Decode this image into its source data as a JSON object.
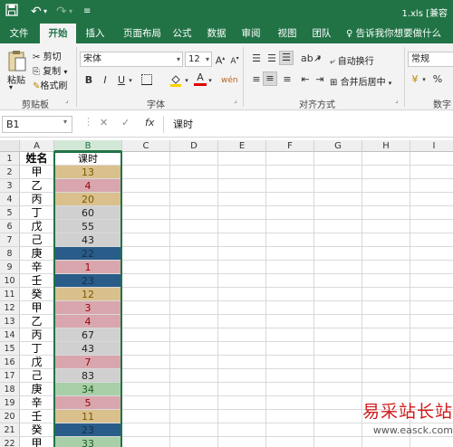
{
  "title_bar": {
    "save_icon": "save-icon",
    "undo_icon": "undo-icon",
    "redo_icon": "redo-icon",
    "customize_icon": "customize-qat-icon",
    "file_title": "1.xls [兼容"
  },
  "tabs": [
    "文件",
    "开始",
    "插入",
    "页面布局",
    "公式",
    "数据",
    "审阅",
    "视图",
    "团队"
  ],
  "tell_me": "告诉我你想要做什么",
  "ribbon": {
    "paste_label": "粘贴",
    "cut_label": "剪切",
    "copy_label": "复制",
    "format_painter_label": "格式刷",
    "clipboard_group": "剪贴板",
    "font_name": "宋体",
    "font_size": "12",
    "bold": "B",
    "italic": "I",
    "underline": "U",
    "font_group": "字体",
    "wrap_text": "自动换行",
    "merge_center": "合并后居中",
    "alignment_group": "对齐方式",
    "number_format": "常规",
    "number_group": "数字",
    "percent": "%"
  },
  "formula_bar": {
    "name_box": "B1",
    "fx": "fx",
    "content": "课时"
  },
  "columns": [
    "A",
    "B",
    "C",
    "D",
    "E",
    "F",
    "G",
    "H",
    "I"
  ],
  "rows": [
    {
      "n": "1",
      "a": "姓名",
      "b": "课时",
      "fill": "#ffffff",
      "color": "#000000"
    },
    {
      "n": "2",
      "a": "甲",
      "b": "13",
      "fill": "#d9c08c",
      "color": "#7a5a00"
    },
    {
      "n": "3",
      "a": "乙",
      "b": "4",
      "fill": "#d9a6ae",
      "color": "#9c0006"
    },
    {
      "n": "4",
      "a": "丙",
      "b": "20",
      "fill": "#d9c08c",
      "color": "#7a5a00"
    },
    {
      "n": "5",
      "a": "丁",
      "b": "60",
      "fill": "#d0d0d0",
      "color": "#222222"
    },
    {
      "n": "6",
      "a": "戊",
      "b": "55",
      "fill": "#d0d0d0",
      "color": "#222222"
    },
    {
      "n": "7",
      "a": "己",
      "b": "43",
      "fill": "#d0d0d0",
      "color": "#222222"
    },
    {
      "n": "8",
      "a": "庚",
      "b": "22",
      "fill": "#2a5c8a",
      "color": "#1a2f4a"
    },
    {
      "n": "9",
      "a": "辛",
      "b": "1",
      "fill": "#d9a6ae",
      "color": "#9c0006"
    },
    {
      "n": "10",
      "a": "壬",
      "b": "23",
      "fill": "#2a5c8a",
      "color": "#1a2f4a"
    },
    {
      "n": "11",
      "a": "癸",
      "b": "12",
      "fill": "#d9c08c",
      "color": "#7a5a00"
    },
    {
      "n": "12",
      "a": "甲",
      "b": "3",
      "fill": "#d9a6ae",
      "color": "#9c0006"
    },
    {
      "n": "13",
      "a": "乙",
      "b": "4",
      "fill": "#d9a6ae",
      "color": "#9c0006"
    },
    {
      "n": "14",
      "a": "丙",
      "b": "67",
      "fill": "#d0d0d0",
      "color": "#222222"
    },
    {
      "n": "15",
      "a": "丁",
      "b": "43",
      "fill": "#d0d0d0",
      "color": "#222222"
    },
    {
      "n": "16",
      "a": "戊",
      "b": "7",
      "fill": "#d9a6ae",
      "color": "#9c0006"
    },
    {
      "n": "17",
      "a": "己",
      "b": "83",
      "fill": "#d0d0d0",
      "color": "#222222"
    },
    {
      "n": "18",
      "a": "庚",
      "b": "34",
      "fill": "#a9cfa9",
      "color": "#1e5e1e"
    },
    {
      "n": "19",
      "a": "辛",
      "b": "5",
      "fill": "#d9a6ae",
      "color": "#9c0006"
    },
    {
      "n": "20",
      "a": "壬",
      "b": "11",
      "fill": "#d9c08c",
      "color": "#7a5a00"
    },
    {
      "n": "21",
      "a": "癸",
      "b": "23",
      "fill": "#2a5c8a",
      "color": "#1a2f4a"
    },
    {
      "n": "22",
      "a": "甲",
      "b": "33",
      "fill": "#a9cfa9",
      "color": "#1e5e1e"
    }
  ],
  "watermark": {
    "text": "易采站长站",
    "url": "www.easck.com"
  }
}
